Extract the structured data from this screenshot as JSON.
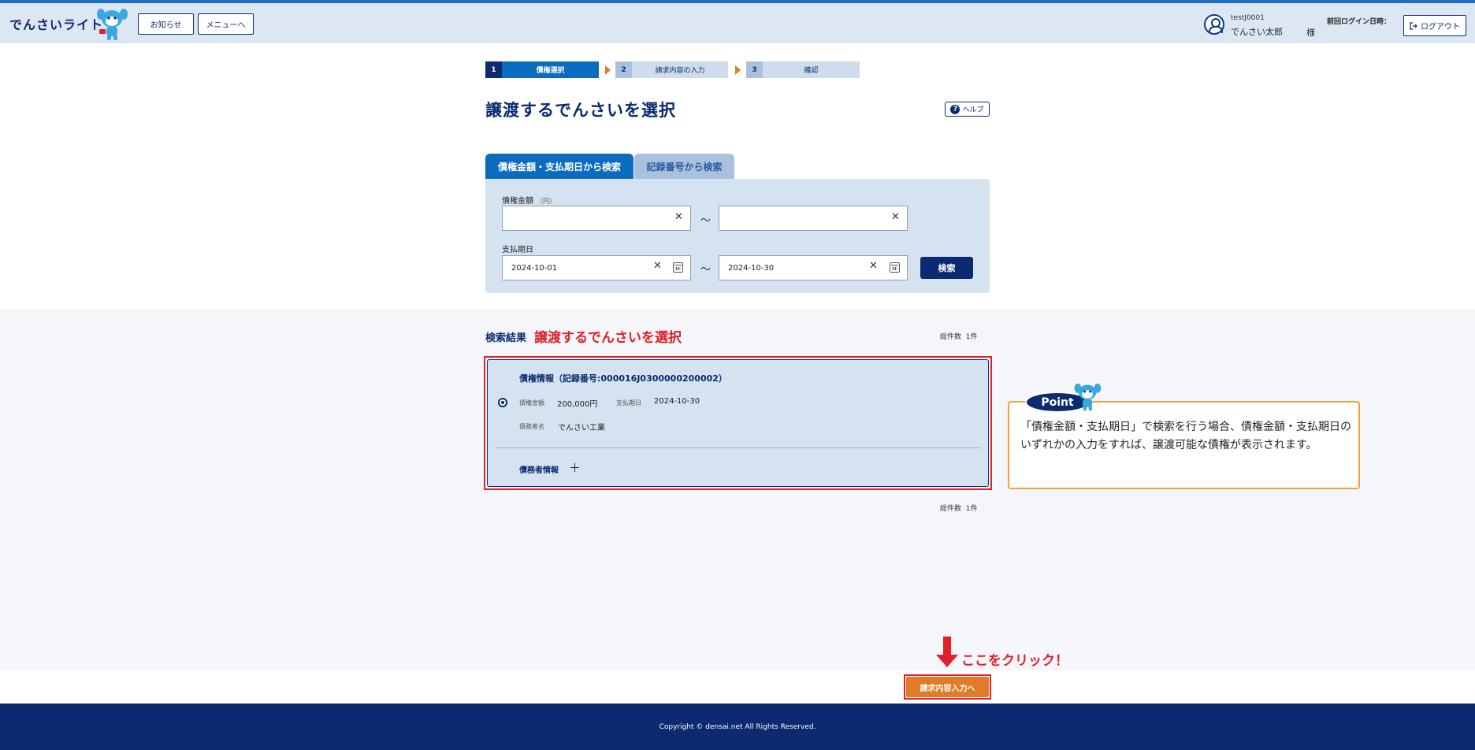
{
  "header": {
    "logo": "でんさいライト",
    "news_button": "お知らせ",
    "menu_button": "メニューへ",
    "user_id": "testJ0001",
    "user_name": "でんさい太郎",
    "honorific": "様",
    "last_login_label": "前回ログイン日時：",
    "logout_button": "ログアウト"
  },
  "steps": [
    {
      "num": "1",
      "label": "債権選択",
      "active": true
    },
    {
      "num": "2",
      "label": "請求内容の入力",
      "active": false
    },
    {
      "num": "3",
      "label": "確認",
      "active": false
    }
  ],
  "page_title": "譲渡するでんさいを選択",
  "help_button": "ヘルプ",
  "tabs": {
    "active": "債権金額・支払期日から検索",
    "inactive": "記録番号から検索"
  },
  "search": {
    "amount_label": "債権金額",
    "amount_unit": "（円）",
    "amount_from": "",
    "amount_to": "",
    "tilde": "～",
    "due_label": "支払期日",
    "due_from": "2024-10-01",
    "due_to": "2024-10-30",
    "search_button": "検索"
  },
  "results": {
    "title": "検索結果",
    "annotation": "譲渡するでんさいを選択",
    "total_label": "総件数",
    "total_count": "1件",
    "card": {
      "heading": "債権情報（記録番号:000016J0300000200002）",
      "amount_label": "債権金額",
      "amount_value": "200,000円",
      "due_label": "支払期日",
      "due_value": "2024-10-30",
      "debtor_label": "債務者名",
      "debtor_value": "でんさい工業",
      "debtor_info": "債務者情報",
      "expand": "＋"
    }
  },
  "point": {
    "badge": "Point",
    "text": "「債権金額・支払期日」で検索を行う場合、債権金額・支払期日のいずれかの入力をすれば、譲渡可能な債権が表示されます。"
  },
  "next_button": "請求内容入力へ",
  "click_annotation": "ここをクリック！",
  "footer": "Copyright © densai.net All Rights Reserved.",
  "colors": {
    "navy": "#0b2a6f",
    "accent_orange": "#e07b27",
    "annotation_red": "#e0202a",
    "step_active": "#0b6cbf",
    "step_inactive": "#cfdcec"
  }
}
